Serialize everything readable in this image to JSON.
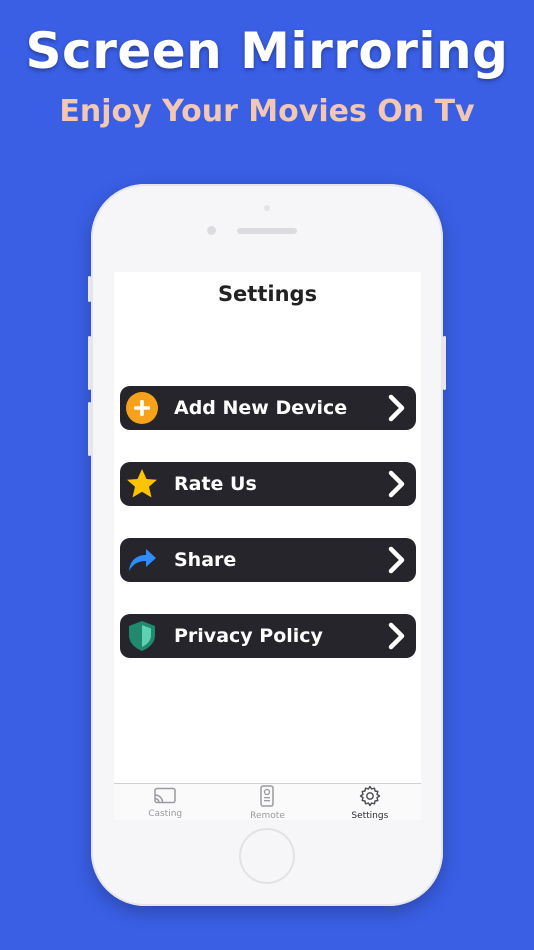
{
  "promo": {
    "headline": "Screen Mirroring",
    "subheadline": "Enjoy Your Movies On Tv"
  },
  "screen": {
    "title": "Settings",
    "menu": [
      {
        "label": "Add New Device",
        "icon": "plus-circle-icon"
      },
      {
        "label": "Rate Us",
        "icon": "star-icon"
      },
      {
        "label": "Share",
        "icon": "share-arrow-icon"
      },
      {
        "label": "Privacy Policy",
        "icon": "shield-icon"
      }
    ],
    "tabs": [
      {
        "label": "Casting",
        "icon": "cast-icon",
        "active": false
      },
      {
        "label": "Remote",
        "icon": "remote-icon",
        "active": false
      },
      {
        "label": "Settings",
        "icon": "gear-icon",
        "active": true
      }
    ]
  },
  "colors": {
    "background": "#3a5fe5",
    "subheadline": "#f2c7b4",
    "menu_item": "#25252b",
    "plus_icon": "#f7a21a",
    "star_icon": "#ffc400",
    "share_icon": "#2f8cff",
    "shield_icon": "#1f8a70"
  }
}
